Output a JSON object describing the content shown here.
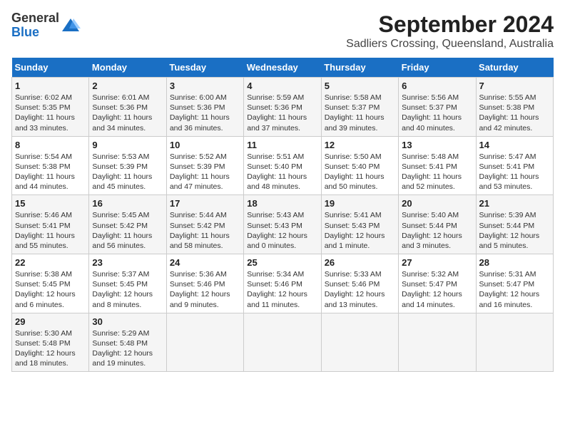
{
  "header": {
    "logo_general": "General",
    "logo_blue": "Blue",
    "title": "September 2024",
    "subtitle": "Sadliers Crossing, Queensland, Australia"
  },
  "weekdays": [
    "Sunday",
    "Monday",
    "Tuesday",
    "Wednesday",
    "Thursday",
    "Friday",
    "Saturday"
  ],
  "weeks": [
    [
      {
        "day": "1",
        "info": "Sunrise: 6:02 AM\nSunset: 5:35 PM\nDaylight: 11 hours\nand 33 minutes."
      },
      {
        "day": "2",
        "info": "Sunrise: 6:01 AM\nSunset: 5:36 PM\nDaylight: 11 hours\nand 34 minutes."
      },
      {
        "day": "3",
        "info": "Sunrise: 6:00 AM\nSunset: 5:36 PM\nDaylight: 11 hours\nand 36 minutes."
      },
      {
        "day": "4",
        "info": "Sunrise: 5:59 AM\nSunset: 5:36 PM\nDaylight: 11 hours\nand 37 minutes."
      },
      {
        "day": "5",
        "info": "Sunrise: 5:58 AM\nSunset: 5:37 PM\nDaylight: 11 hours\nand 39 minutes."
      },
      {
        "day": "6",
        "info": "Sunrise: 5:56 AM\nSunset: 5:37 PM\nDaylight: 11 hours\nand 40 minutes."
      },
      {
        "day": "7",
        "info": "Sunrise: 5:55 AM\nSunset: 5:38 PM\nDaylight: 11 hours\nand 42 minutes."
      }
    ],
    [
      {
        "day": "8",
        "info": "Sunrise: 5:54 AM\nSunset: 5:38 PM\nDaylight: 11 hours\nand 44 minutes."
      },
      {
        "day": "9",
        "info": "Sunrise: 5:53 AM\nSunset: 5:39 PM\nDaylight: 11 hours\nand 45 minutes."
      },
      {
        "day": "10",
        "info": "Sunrise: 5:52 AM\nSunset: 5:39 PM\nDaylight: 11 hours\nand 47 minutes."
      },
      {
        "day": "11",
        "info": "Sunrise: 5:51 AM\nSunset: 5:40 PM\nDaylight: 11 hours\nand 48 minutes."
      },
      {
        "day": "12",
        "info": "Sunrise: 5:50 AM\nSunset: 5:40 PM\nDaylight: 11 hours\nand 50 minutes."
      },
      {
        "day": "13",
        "info": "Sunrise: 5:48 AM\nSunset: 5:41 PM\nDaylight: 11 hours\nand 52 minutes."
      },
      {
        "day": "14",
        "info": "Sunrise: 5:47 AM\nSunset: 5:41 PM\nDaylight: 11 hours\nand 53 minutes."
      }
    ],
    [
      {
        "day": "15",
        "info": "Sunrise: 5:46 AM\nSunset: 5:41 PM\nDaylight: 11 hours\nand 55 minutes."
      },
      {
        "day": "16",
        "info": "Sunrise: 5:45 AM\nSunset: 5:42 PM\nDaylight: 11 hours\nand 56 minutes."
      },
      {
        "day": "17",
        "info": "Sunrise: 5:44 AM\nSunset: 5:42 PM\nDaylight: 11 hours\nand 58 minutes."
      },
      {
        "day": "18",
        "info": "Sunrise: 5:43 AM\nSunset: 5:43 PM\nDaylight: 12 hours\nand 0 minutes."
      },
      {
        "day": "19",
        "info": "Sunrise: 5:41 AM\nSunset: 5:43 PM\nDaylight: 12 hours\nand 1 minute."
      },
      {
        "day": "20",
        "info": "Sunrise: 5:40 AM\nSunset: 5:44 PM\nDaylight: 12 hours\nand 3 minutes."
      },
      {
        "day": "21",
        "info": "Sunrise: 5:39 AM\nSunset: 5:44 PM\nDaylight: 12 hours\nand 5 minutes."
      }
    ],
    [
      {
        "day": "22",
        "info": "Sunrise: 5:38 AM\nSunset: 5:45 PM\nDaylight: 12 hours\nand 6 minutes."
      },
      {
        "day": "23",
        "info": "Sunrise: 5:37 AM\nSunset: 5:45 PM\nDaylight: 12 hours\nand 8 minutes."
      },
      {
        "day": "24",
        "info": "Sunrise: 5:36 AM\nSunset: 5:46 PM\nDaylight: 12 hours\nand 9 minutes."
      },
      {
        "day": "25",
        "info": "Sunrise: 5:34 AM\nSunset: 5:46 PM\nDaylight: 12 hours\nand 11 minutes."
      },
      {
        "day": "26",
        "info": "Sunrise: 5:33 AM\nSunset: 5:46 PM\nDaylight: 12 hours\nand 13 minutes."
      },
      {
        "day": "27",
        "info": "Sunrise: 5:32 AM\nSunset: 5:47 PM\nDaylight: 12 hours\nand 14 minutes."
      },
      {
        "day": "28",
        "info": "Sunrise: 5:31 AM\nSunset: 5:47 PM\nDaylight: 12 hours\nand 16 minutes."
      }
    ],
    [
      {
        "day": "29",
        "info": "Sunrise: 5:30 AM\nSunset: 5:48 PM\nDaylight: 12 hours\nand 18 minutes."
      },
      {
        "day": "30",
        "info": "Sunrise: 5:29 AM\nSunset: 5:48 PM\nDaylight: 12 hours\nand 19 minutes."
      },
      {
        "day": "",
        "info": ""
      },
      {
        "day": "",
        "info": ""
      },
      {
        "day": "",
        "info": ""
      },
      {
        "day": "",
        "info": ""
      },
      {
        "day": "",
        "info": ""
      }
    ]
  ]
}
